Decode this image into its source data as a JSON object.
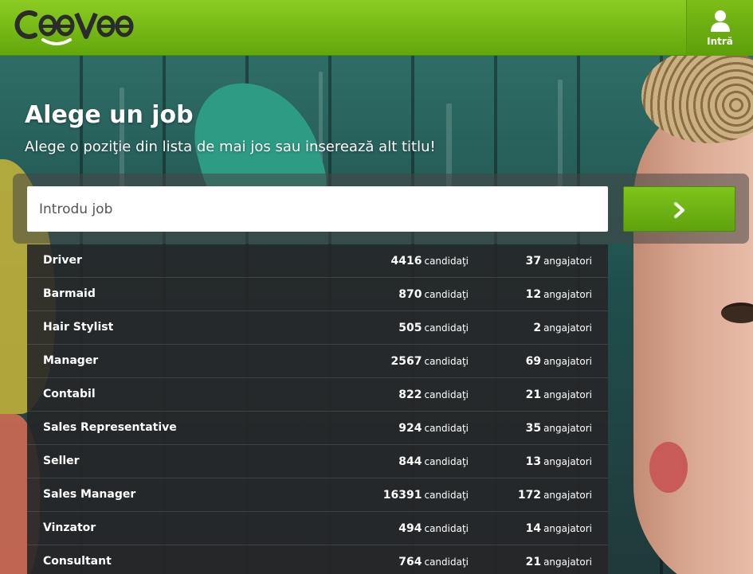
{
  "header": {
    "logo_text": "CeeVee",
    "login_label": "Intră",
    "colors": {
      "brand_green": "#6fb513",
      "brand_dark": "#2b2b2b"
    }
  },
  "hero": {
    "title": "Alege un job",
    "subtitle": "Alege o poziţie din lista de mai jos sau inserează alt titlu!"
  },
  "search": {
    "placeholder": "Introdu job",
    "value": "",
    "submit_icon": "chevron-right-icon"
  },
  "jobs": [
    {
      "title": "Driver",
      "candidates": "4416",
      "candidates_label": "candidaţi",
      "employers": "37",
      "employers_label": "angajatori"
    },
    {
      "title": "Barmaid",
      "candidates": "870",
      "candidates_label": "candidaţi",
      "employers": "12",
      "employers_label": "angajatori"
    },
    {
      "title": "Hair Stylist",
      "candidates": "505",
      "candidates_label": "candidaţi",
      "employers": "2",
      "employers_label": "angajatori"
    },
    {
      "title": "Manager",
      "candidates": "2567",
      "candidates_label": "candidaţi",
      "employers": "69",
      "employers_label": "angajatori"
    },
    {
      "title": "Contabil",
      "candidates": "822",
      "candidates_label": "candidaţi",
      "employers": "21",
      "employers_label": "angajatori"
    },
    {
      "title": "Sales Representative",
      "candidates": "924",
      "candidates_label": "candidaţi",
      "employers": "35",
      "employers_label": "angajatori"
    },
    {
      "title": "Seller",
      "candidates": "844",
      "candidates_label": "candidaţi",
      "employers": "13",
      "employers_label": "angajatori"
    },
    {
      "title": "Sales Manager",
      "candidates": "16391",
      "candidates_label": "candidaţi",
      "employers": "172",
      "employers_label": "angajatori"
    },
    {
      "title": "Vinzator",
      "candidates": "494",
      "candidates_label": "candidaţi",
      "employers": "14",
      "employers_label": "angajatori"
    },
    {
      "title": "Consultant",
      "candidates": "764",
      "candidates_label": "candidaţi",
      "employers": "21",
      "employers_label": "angajatori"
    }
  ]
}
